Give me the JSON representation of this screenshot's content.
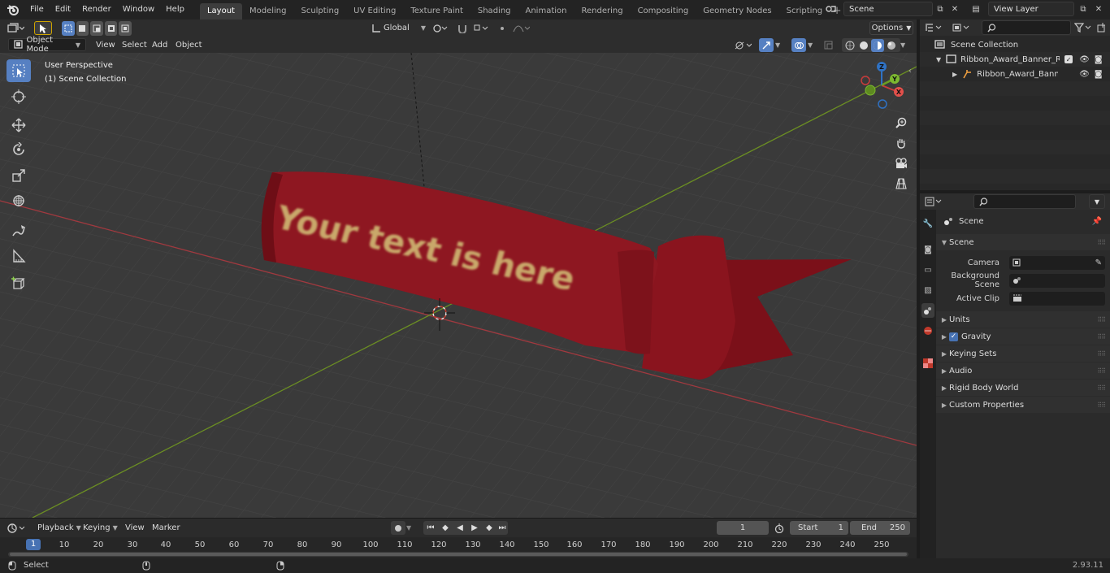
{
  "topbar": {
    "menus": [
      "File",
      "Edit",
      "Render",
      "Window",
      "Help"
    ],
    "workspaces": [
      "Layout",
      "Modeling",
      "Sculpting",
      "UV Editing",
      "Texture Paint",
      "Shading",
      "Animation",
      "Rendering",
      "Compositing",
      "Geometry Nodes",
      "Scripting"
    ],
    "active_workspace": "Layout",
    "scene_name": "Scene",
    "view_layer": "View Layer"
  },
  "viewport_header": {
    "transform_orientation": "Global",
    "options_label": "Options"
  },
  "tool_header": {
    "mode": "Object Mode",
    "menus": [
      "View",
      "Select",
      "Add",
      "Object"
    ]
  },
  "viewport": {
    "perspective_label": "User Perspective",
    "collection_label": "(1) Scene Collection",
    "banner_text": "Your text is here",
    "colors": {
      "banner": "#8e1721",
      "x_axis": "#a0393f",
      "y_axis": "#6b8e23",
      "text": "#c9a86a"
    }
  },
  "gizmo": {
    "x": "X",
    "y": "Y",
    "z": "Z"
  },
  "outliner": {
    "root": "Scene Collection",
    "items": [
      {
        "label": "Ribbon_Award_Banner_Red_(",
        "level": 1
      },
      {
        "label": "Ribbon_Award_Banner_R",
        "level": 2
      }
    ]
  },
  "properties": {
    "title": "Scene",
    "section": "Scene",
    "fields": [
      {
        "label": "Camera",
        "value": ""
      },
      {
        "label": "Background Scene",
        "value": ""
      },
      {
        "label": "Active Clip",
        "value": ""
      }
    ],
    "subpanels": [
      "Units",
      "Gravity",
      "Keying Sets",
      "Audio",
      "Rigid Body World",
      "Custom Properties"
    ],
    "gravity_checked": true
  },
  "timeline": {
    "menus": [
      "Playback",
      "Keying",
      "View",
      "Marker"
    ],
    "current_frame": "1",
    "start_label": "Start",
    "start": "1",
    "end_label": "End",
    "end": "250",
    "ruler_cursor": "1",
    "ruler": [
      "10",
      "20",
      "30",
      "40",
      "50",
      "60",
      "70",
      "80",
      "90",
      "100",
      "110",
      "120",
      "130",
      "140",
      "150",
      "160",
      "170",
      "180",
      "190",
      "200",
      "210",
      "220",
      "230",
      "240",
      "250"
    ]
  },
  "statusbar": {
    "select_label": "Select",
    "version": "2.93.11"
  }
}
